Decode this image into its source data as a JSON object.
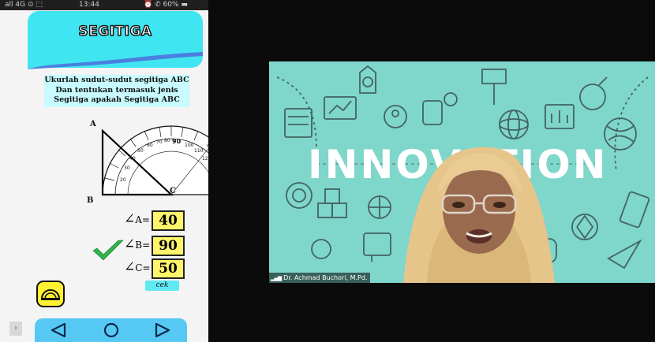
{
  "status_bar": {
    "left": "all 4G  ⊙ ⬚",
    "time": "13:44",
    "right": "⏰ ✆ 60% ▬"
  },
  "app": {
    "title": "SEGITIGA"
  },
  "instruction": {
    "line1": "Ukurlah sudut-sudut segitiga ABC",
    "line2": "Dan tentukan termasuk jenis",
    "line3": "Segitiga apakah Segitiga ABC"
  },
  "figure": {
    "vertex_a": "A",
    "vertex_b": "B",
    "vertex_c": "C"
  },
  "angles": [
    {
      "symbol": "∠",
      "label": "A",
      "eq": "=",
      "value": "40"
    },
    {
      "symbol": "∠",
      "label": "B",
      "eq": "=",
      "value": "90"
    },
    {
      "symbol": "∠",
      "label": "C",
      "eq": "=",
      "value": "50"
    }
  ],
  "buttons": {
    "cek": "cek"
  },
  "video": {
    "banner_text": "INNOVATION",
    "participant_name": "Dr. Achmad Buchori, M.Pd."
  },
  "colors": {
    "header": "#3fe6f2",
    "answer_box": "#fff46a",
    "nav_bar": "#56c8f4",
    "video_bg": "#7fd6cb"
  }
}
